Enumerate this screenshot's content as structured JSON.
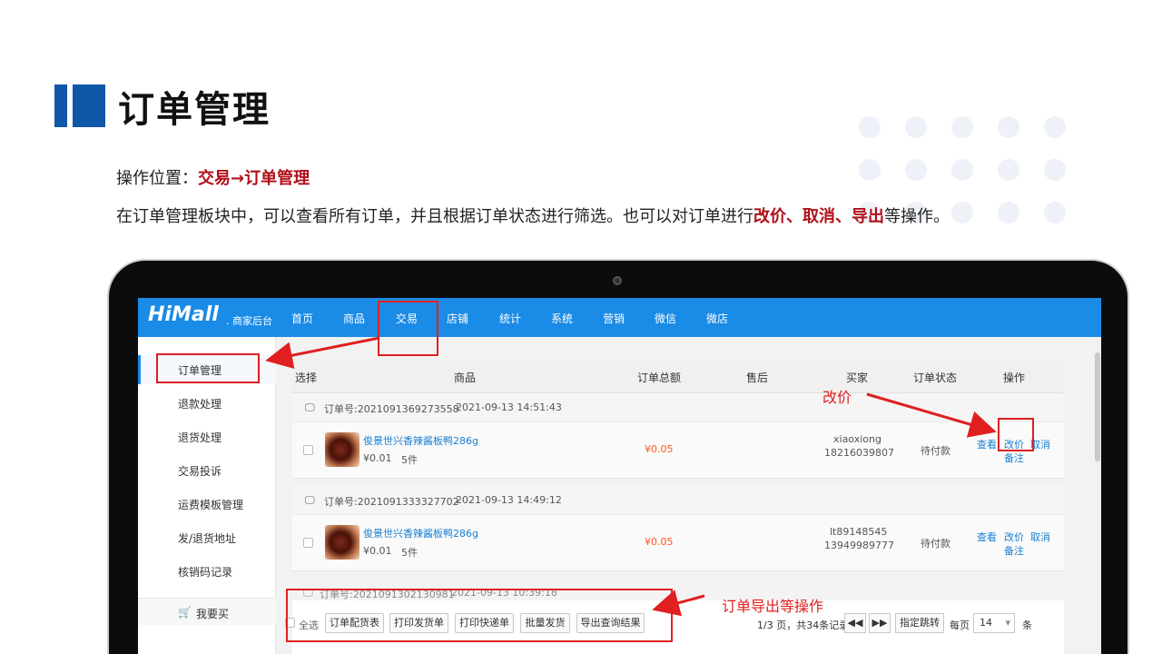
{
  "slide": {
    "title": "订单管理",
    "location_label": "操作位置：",
    "location_path": "交易→订单管理",
    "desc_prefix": "在订单管理板块中，可以查看所有订单，并且根据订单状态进行筛选。也可以对订单进行",
    "desc_highlight": "改价、取消、导出",
    "desc_suffix": "等操作。"
  },
  "app": {
    "logo": "HiMall",
    "logo_sub": ". 商家后台",
    "nav": [
      "首页",
      "商品",
      "交易",
      "店铺",
      "统计",
      "系统",
      "营销",
      "微信",
      "微店"
    ],
    "active_nav": "交易"
  },
  "sidebar": {
    "items": [
      "订单管理",
      "退款处理",
      "退货处理",
      "交易投诉",
      "运费模板管理",
      "发/退货地址",
      "核销码记录"
    ],
    "buy": "我要买"
  },
  "table": {
    "headers": [
      "选择",
      "商品",
      "订单总额",
      "售后",
      "买家",
      "订单状态",
      "操作"
    ]
  },
  "orders": [
    {
      "order_no": "订单号:2021091369273558",
      "time": "2021-09-13 14:51:43",
      "product": "俊景世兴香辣酱板鸭286g",
      "unit_price": "¥0.01",
      "qty": "5件",
      "total": "¥0.05",
      "buyer_name": "xiaoxiong",
      "buyer_phone": "18216039807",
      "status": "待付款",
      "actions": [
        "查看",
        "改价",
        "取消",
        "备注"
      ]
    },
    {
      "order_no": "订单号:2021091333327702",
      "time": "2021-09-13 14:49:12",
      "product": "俊景世兴香辣酱板鸭286g",
      "unit_price": "¥0.01",
      "qty": "5件",
      "total": "¥0.05",
      "buyer_name": "lt89148545",
      "buyer_phone": "13949989777",
      "status": "待付款",
      "actions": [
        "查看",
        "改价",
        "取消",
        "备注"
      ]
    },
    {
      "order_no": "订单号:2021091302130981",
      "time": "2021-09-13 10:39:18"
    }
  ],
  "footer": {
    "select_all": "全选",
    "buttons": [
      "订单配货表",
      "打印发货单",
      "打印快递单",
      "批量发货",
      "导出查询结果"
    ],
    "page_info": "1/3 页，共34条记录",
    "prev": "◀◀",
    "next": "▶▶",
    "jump": "指定跳转",
    "per_page_label": "每页",
    "per_page": "14",
    "per_page_unit": "条"
  },
  "annotations": {
    "price_label": "改价",
    "export_label": "订单导出等操作"
  },
  "colors": {
    "accent_blue": "#0f57a8",
    "nav_blue": "#1a8be6",
    "highlight_red": "#b0101a",
    "annotation_red": "#e02020",
    "price_orange": "#ff5a1f"
  }
}
